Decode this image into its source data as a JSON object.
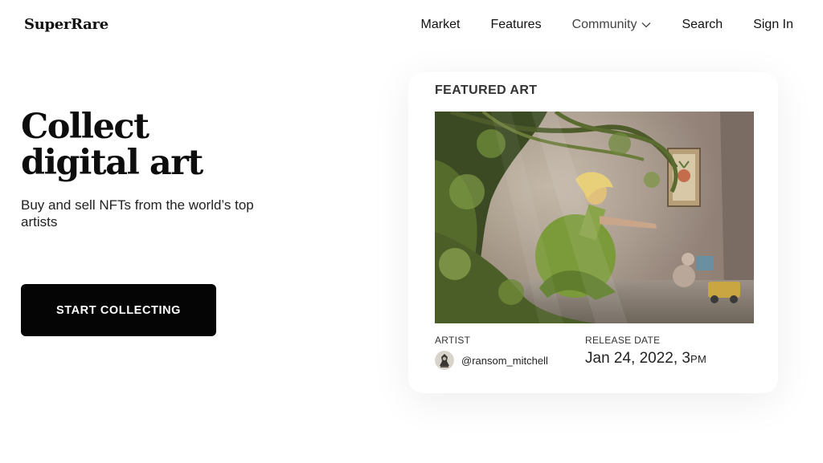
{
  "header": {
    "logo": "SuperRare",
    "nav": {
      "market": "Market",
      "features": "Features",
      "community": "Community",
      "search": "Search",
      "sign_in": "Sign In"
    }
  },
  "hero": {
    "title_line1": "Collect",
    "title_line2": "digital art",
    "subtitle": "Buy and sell NFTs from the world’s top artists",
    "cta_label": "START COLLECTING"
  },
  "featured": {
    "heading": "FEATURED ART",
    "artist_label": "ARTIST",
    "artist_handle": "@ransom_mitchell",
    "release_label": "RELEASE DATE",
    "release_date": "Jan 24, 2022, 3",
    "release_time_suffix": "PM"
  },
  "colors": {
    "cta_background": "#050505",
    "text": "#111111",
    "background": "#ffffff"
  },
  "icons": {
    "community_dropdown": "chevron-down-icon",
    "artist_avatar": "avatar"
  }
}
